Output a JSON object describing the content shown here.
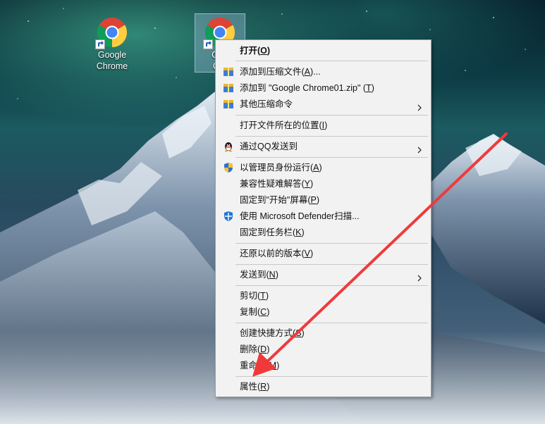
{
  "desktop": {
    "icons": [
      {
        "line1": "Google",
        "line2": "Chrome"
      },
      {
        "line1": "Goo",
        "line2": "Chr"
      }
    ]
  },
  "context_menu": {
    "items": [
      {
        "pre": "打开(",
        "key": "O",
        "post": ")",
        "icon": ""
      },
      {
        "pre": "添加到压缩文件(",
        "key": "A",
        "post": ")...",
        "icon": "archive-icon"
      },
      {
        "pre": "添加到 \"Google Chrome01.zip\" (",
        "key": "T",
        "post": ")",
        "icon": "archive-icon"
      },
      {
        "pre": "其他压缩命令",
        "key": "",
        "post": "",
        "icon": "archive-icon"
      },
      {
        "pre": "打开文件所在的位置(",
        "key": "I",
        "post": ")",
        "icon": ""
      },
      {
        "pre": "通过QQ发送到",
        "key": "",
        "post": "",
        "icon": "qq-icon"
      },
      {
        "pre": "以管理员身份运行(",
        "key": "A",
        "post": ")",
        "icon": "uac-shield-icon"
      },
      {
        "pre": "兼容性疑难解答(",
        "key": "Y",
        "post": ")",
        "icon": ""
      },
      {
        "pre": "固定到\"开始\"屏幕(",
        "key": "P",
        "post": ")",
        "icon": ""
      },
      {
        "pre": "使用 Microsoft Defender扫描...",
        "key": "",
        "post": "",
        "icon": "defender-icon"
      },
      {
        "pre": "固定到任务栏(",
        "key": "K",
        "post": ")",
        "icon": ""
      },
      {
        "pre": "还原以前的版本(",
        "key": "V",
        "post": ")",
        "icon": ""
      },
      {
        "pre": "发送到(",
        "key": "N",
        "post": ")",
        "icon": ""
      },
      {
        "pre": "剪切(",
        "key": "T",
        "post": ")",
        "icon": ""
      },
      {
        "pre": "复制(",
        "key": "C",
        "post": ")",
        "icon": ""
      },
      {
        "pre": "创建快捷方式(",
        "key": "S",
        "post": ")",
        "icon": ""
      },
      {
        "pre": "删除(",
        "key": "D",
        "post": ")",
        "icon": ""
      },
      {
        "pre": "重命名(",
        "key": "M",
        "post": ")",
        "icon": ""
      },
      {
        "pre": "属性(",
        "key": "R",
        "post": ")",
        "icon": ""
      }
    ]
  },
  "colors": {
    "annotation_arrow": "#f03a3a",
    "menu_bg": "#f2f2f2"
  }
}
